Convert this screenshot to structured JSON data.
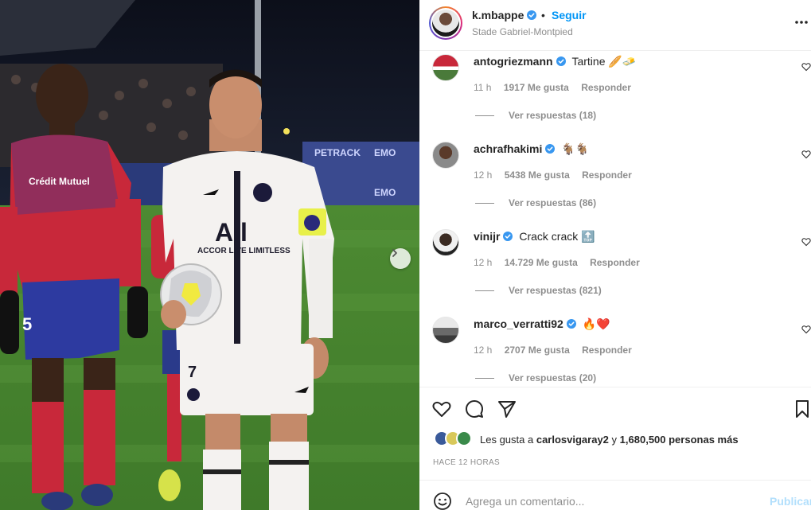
{
  "post": {
    "username": "k.mbappe",
    "follow_label": "Seguir",
    "separator": "•",
    "location": "Stade Gabriel-Montpied",
    "photo": {
      "left_player_number": "5",
      "right_player_number": "7",
      "sponsor_left": "Crédit Mutuel",
      "sponsor_right": "ACCOR LIVE LIMITLESS",
      "sponsor_right_big": "All"
    }
  },
  "comments": [
    {
      "user": "antogriezmann",
      "text": "Tartine",
      "emoji": "🥖🧈",
      "time": "11 h",
      "likes": "1917 Me gusta",
      "reply": "Responder",
      "replies": "Ver respuestas (18)"
    },
    {
      "user": "achrafhakimi",
      "text": "",
      "emoji": "🐐🐐",
      "time": "12 h",
      "likes": "5438 Me gusta",
      "reply": "Responder",
      "replies": "Ver respuestas (86)"
    },
    {
      "user": "vinijr",
      "text": "Crack crack",
      "emoji": "🔝",
      "time": "12 h",
      "likes": "14.729 Me gusta",
      "reply": "Responder",
      "replies": "Ver respuestas (821)"
    },
    {
      "user": "marco_verratti92",
      "text": "",
      "emoji": "🔥❤️",
      "time": "12 h",
      "likes": "2707 Me gusta",
      "reply": "Responder",
      "replies": "Ver respuestas (20)"
    }
  ],
  "likes": {
    "prefix": "Les gusta a",
    "user": "carlosvigaray2",
    "middle": "y",
    "count": "1,680,500 personas más"
  },
  "timestamp": "HACE 12 HORAS",
  "add_comment": {
    "placeholder": "Agrega un comentario...",
    "publish_label": "Publicar"
  },
  "icons": {
    "more": "more-options-icon",
    "like": "heart-icon",
    "comment": "comment-icon",
    "share": "send-icon",
    "save": "bookmark-icon",
    "emoji": "emoji-icon",
    "next": "chevron-right-icon",
    "verified": "verified-badge-icon"
  },
  "colors": {
    "accent": "#0095f6",
    "publish_disabled": "#b2dffc",
    "muted": "#8e8e8e",
    "verified": "#3897f0"
  }
}
